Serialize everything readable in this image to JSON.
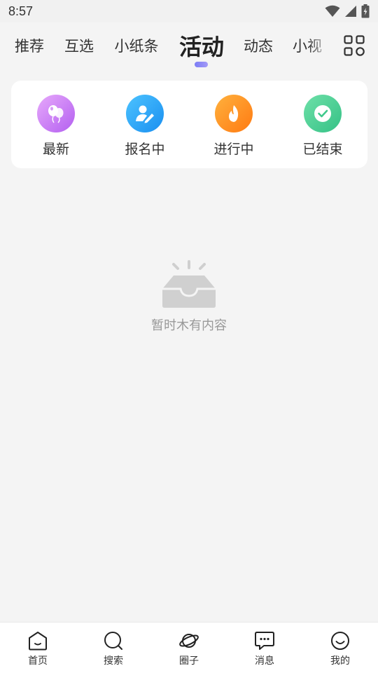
{
  "status_bar": {
    "time": "8:57",
    "icons": [
      "wifi-icon",
      "signal-icon",
      "battery-charging-icon"
    ]
  },
  "tabs": [
    {
      "label": "推荐",
      "active": false
    },
    {
      "label": "互选",
      "active": false
    },
    {
      "label": "小纸条",
      "active": false
    },
    {
      "label": "活动",
      "active": true
    },
    {
      "label": "动态",
      "active": false
    },
    {
      "label": "小视",
      "active": false
    }
  ],
  "tab_menu_icon": "grid-icon",
  "categories": [
    {
      "label": "最新",
      "icon": "balloons-icon",
      "color": "#c77df2"
    },
    {
      "label": "报名中",
      "icon": "user-edit-icon",
      "color": "#29a3f5"
    },
    {
      "label": "进行中",
      "icon": "flame-icon",
      "color": "#ff8a1e"
    },
    {
      "label": "已结束",
      "icon": "check-icon",
      "color": "#4ccf94"
    }
  ],
  "empty_state": {
    "icon": "empty-tray-icon",
    "text": "暂时木有内容"
  },
  "bottom_nav": [
    {
      "label": "首页",
      "icon": "home-icon"
    },
    {
      "label": "搜索",
      "icon": "search-icon"
    },
    {
      "label": "圈子",
      "icon": "planet-icon"
    },
    {
      "label": "消息",
      "icon": "chat-icon"
    },
    {
      "label": "我的",
      "icon": "smile-icon"
    }
  ]
}
